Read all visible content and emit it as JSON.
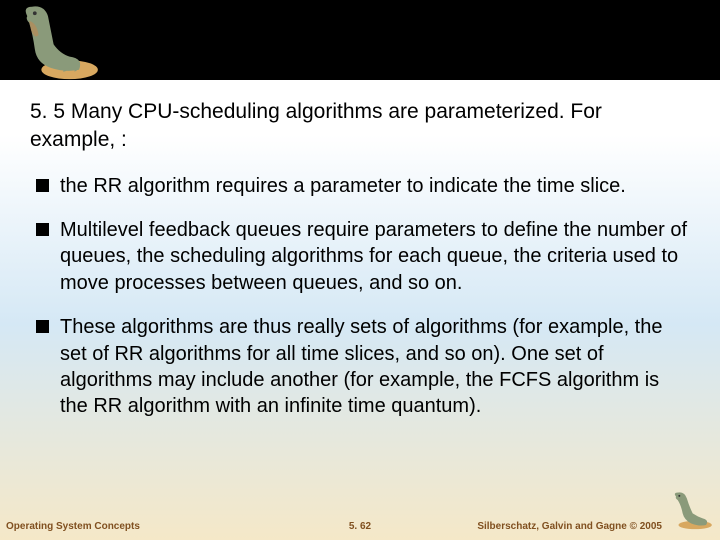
{
  "heading": "5. 5 Many CPU-scheduling algorithms are parameterized. For example, :",
  "bullets": [
    "the RR algorithm requires a parameter to indicate the time slice.",
    "Multilevel feedback queues require parameters to define the number of queues, the scheduling algorithms for each queue, the criteria used to move processes between queues, and so on.",
    "These algorithms are thus really sets of algorithms (for example, the set of RR algorithms for all time slices, and so on). One set of algorithms may include another (for example, the FCFS algorithm is the RR algorithm with an infinite time quantum)."
  ],
  "footer": {
    "left": "Operating System Concepts",
    "center": "5. 62",
    "right": "Silberschatz, Galvin and Gagne © 2005"
  }
}
